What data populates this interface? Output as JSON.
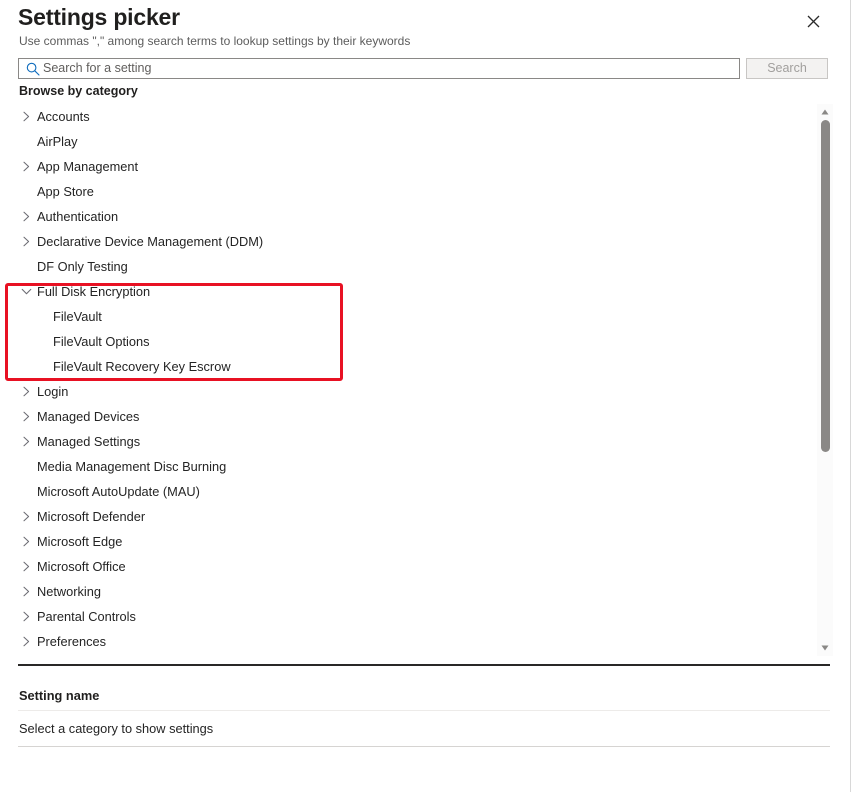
{
  "header": {
    "title": "Settings picker",
    "subtitle": "Use commas \",\" among search terms to lookup settings by their keywords",
    "close_icon": "close-icon"
  },
  "search": {
    "icon": "search-icon",
    "placeholder": "Search for a setting",
    "value": "",
    "button_label": "Search",
    "button_disabled": true
  },
  "browse": {
    "label": "Browse by category"
  },
  "categories": [
    {
      "label": "Accounts",
      "level": 0,
      "expandable": true,
      "expanded": false
    },
    {
      "label": "AirPlay",
      "level": 0,
      "expandable": false,
      "expanded": false
    },
    {
      "label": "App Management",
      "level": 0,
      "expandable": true,
      "expanded": false
    },
    {
      "label": "App Store",
      "level": 0,
      "expandable": false,
      "expanded": false
    },
    {
      "label": "Authentication",
      "level": 0,
      "expandable": true,
      "expanded": false
    },
    {
      "label": "Declarative Device Management (DDM)",
      "level": 0,
      "expandable": true,
      "expanded": false
    },
    {
      "label": "DF Only Testing",
      "level": 0,
      "expandable": false,
      "expanded": false
    },
    {
      "label": "Full Disk Encryption",
      "level": 0,
      "expandable": true,
      "expanded": true
    },
    {
      "label": "FileVault",
      "level": 1,
      "expandable": false,
      "expanded": false
    },
    {
      "label": "FileVault Options",
      "level": 1,
      "expandable": false,
      "expanded": false
    },
    {
      "label": "FileVault Recovery Key Escrow",
      "level": 1,
      "expandable": false,
      "expanded": false
    },
    {
      "label": "Login",
      "level": 0,
      "expandable": true,
      "expanded": false
    },
    {
      "label": "Managed Devices",
      "level": 0,
      "expandable": true,
      "expanded": false
    },
    {
      "label": "Managed Settings",
      "level": 0,
      "expandable": true,
      "expanded": false
    },
    {
      "label": "Media Management Disc Burning",
      "level": 0,
      "expandable": false,
      "expanded": false
    },
    {
      "label": "Microsoft AutoUpdate (MAU)",
      "level": 0,
      "expandable": false,
      "expanded": false
    },
    {
      "label": "Microsoft Defender",
      "level": 0,
      "expandable": true,
      "expanded": false
    },
    {
      "label": "Microsoft Edge",
      "level": 0,
      "expandable": true,
      "expanded": false
    },
    {
      "label": "Microsoft Office",
      "level": 0,
      "expandable": true,
      "expanded": false
    },
    {
      "label": "Networking",
      "level": 0,
      "expandable": true,
      "expanded": false
    },
    {
      "label": "Parental Controls",
      "level": 0,
      "expandable": true,
      "expanded": false
    },
    {
      "label": "Preferences",
      "level": 0,
      "expandable": true,
      "expanded": false
    }
  ],
  "scrollbar": {
    "up_icon": "scroll-up-arrow-icon",
    "down_icon": "scroll-down-arrow-icon"
  },
  "annotation": {
    "color": "#e81123",
    "target": "Full Disk Encryption"
  },
  "settings_pane": {
    "column_header": "Setting name",
    "empty_message": "Select a category to show settings"
  }
}
